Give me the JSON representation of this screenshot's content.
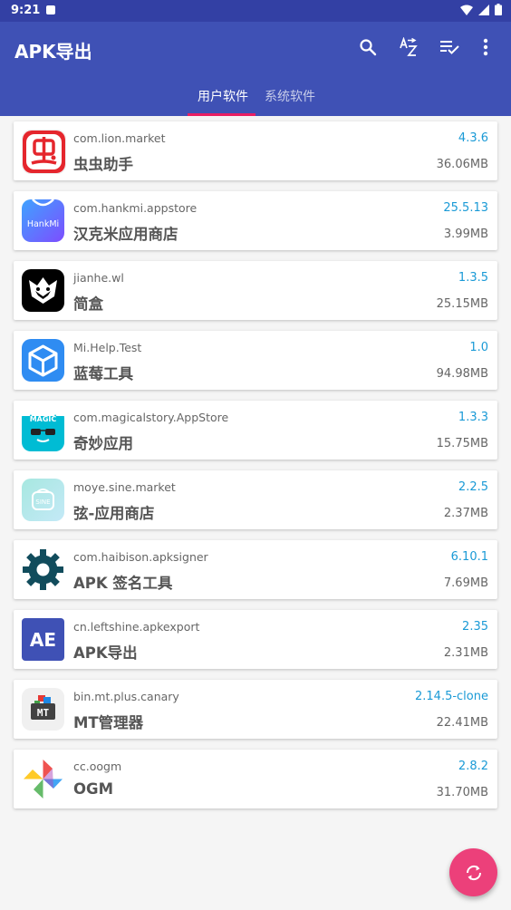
{
  "status": {
    "time": "9:21"
  },
  "app": {
    "title": "APK导出"
  },
  "actions": {
    "search": "search-icon",
    "sort": "sort-az-icon",
    "select": "playlist-check-icon",
    "more": "more-vert-icon"
  },
  "tabs": [
    {
      "label": "用户软件",
      "active": true
    },
    {
      "label": "系统软件",
      "active": false
    }
  ],
  "apps": [
    {
      "package": "com.lion.market",
      "name": "虫虫助手",
      "version": "4.3.6",
      "size": "36.06MB"
    },
    {
      "package": "com.hankmi.appstore",
      "name": "汉克米应用商店",
      "version": "25.5.13",
      "size": "3.99MB"
    },
    {
      "package": "jianhe.wl",
      "name": "简盒",
      "version": "1.3.5",
      "size": "25.15MB"
    },
    {
      "package": "Mi.Help.Test",
      "name": "蓝莓工具",
      "version": "1.0",
      "size": "94.98MB"
    },
    {
      "package": "com.magicalstory.AppStore",
      "name": "奇妙应用",
      "version": "1.3.3",
      "size": "15.75MB"
    },
    {
      "package": "moye.sine.market",
      "name": "弦-应用商店",
      "version": "2.2.5",
      "size": "2.37MB"
    },
    {
      "package": "com.haibison.apksigner",
      "name": "APK 签名工具",
      "version": "6.10.1",
      "size": "7.69MB"
    },
    {
      "package": "cn.leftshine.apkexport",
      "name": "APK导出",
      "version": "2.35",
      "size": "2.31MB"
    },
    {
      "package": "bin.mt.plus.canary",
      "name": "MT管理器",
      "version": "2.14.5-clone",
      "size": "22.41MB"
    },
    {
      "package": "cc.oogm",
      "name": "OGM",
      "version": "2.8.2",
      "size": "31.70MB"
    }
  ],
  "icon_text": {
    "hankmi": "HankMi",
    "magic": "MAGIC",
    "sine": "SINE",
    "ae": "AE",
    "mt": "MT"
  },
  "colors": {
    "primary": "#3f51b5",
    "status_bar": "#3340a4",
    "accent": "#e91e63",
    "fab": "#ec407a",
    "version_text": "#1a9ad6"
  }
}
